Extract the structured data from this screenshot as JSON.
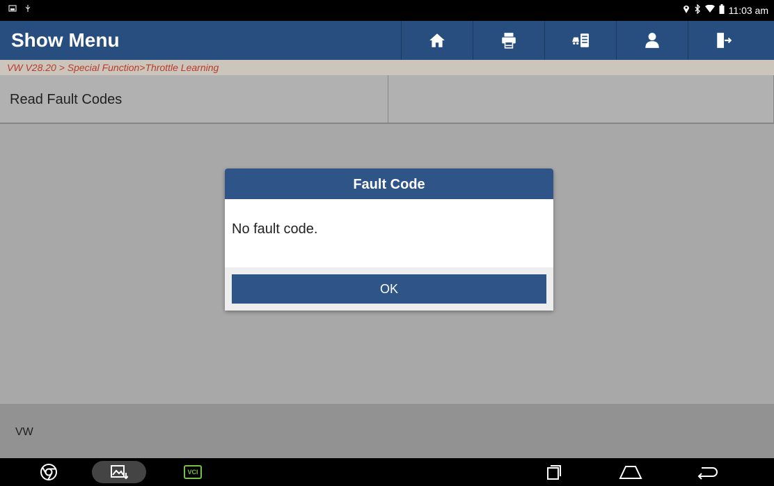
{
  "status_bar": {
    "time": "11:03 am",
    "left_icons": [
      "screenshot-icon",
      "usb-icon"
    ],
    "right_icons": [
      "location-icon",
      "bluetooth-icon",
      "wifi-icon",
      "battery-icon"
    ]
  },
  "header": {
    "title": "Show Menu",
    "toolbar": [
      {
        "name": "home-button",
        "icon": "home-icon"
      },
      {
        "name": "print-button",
        "icon": "printer-icon"
      },
      {
        "name": "report-button",
        "icon": "car-report-icon"
      },
      {
        "name": "user-button",
        "icon": "user-icon"
      },
      {
        "name": "exit-button",
        "icon": "exit-icon"
      }
    ]
  },
  "breadcrumb": "VW V28.20 > Special Function>Throttle Learning",
  "menu": {
    "items": [
      "Read Fault Codes",
      ""
    ]
  },
  "dialog": {
    "title": "Fault Code",
    "message": "No fault code.",
    "ok_label": "OK"
  },
  "footer": {
    "brand": "VW"
  },
  "navbar": {
    "vci_label": "VCI",
    "icons": [
      "chrome-icon",
      "gallery-icon",
      "vci-icon",
      "recent-apps-icon",
      "home-nav-icon",
      "back-icon"
    ]
  },
  "colors": {
    "header_bg": "#274e7f",
    "dialog_title_bg": "#2f5487",
    "breadcrumb_text": "#c53f2c",
    "content_bg": "#b3b3b3",
    "vci_green": "#79c043"
  }
}
